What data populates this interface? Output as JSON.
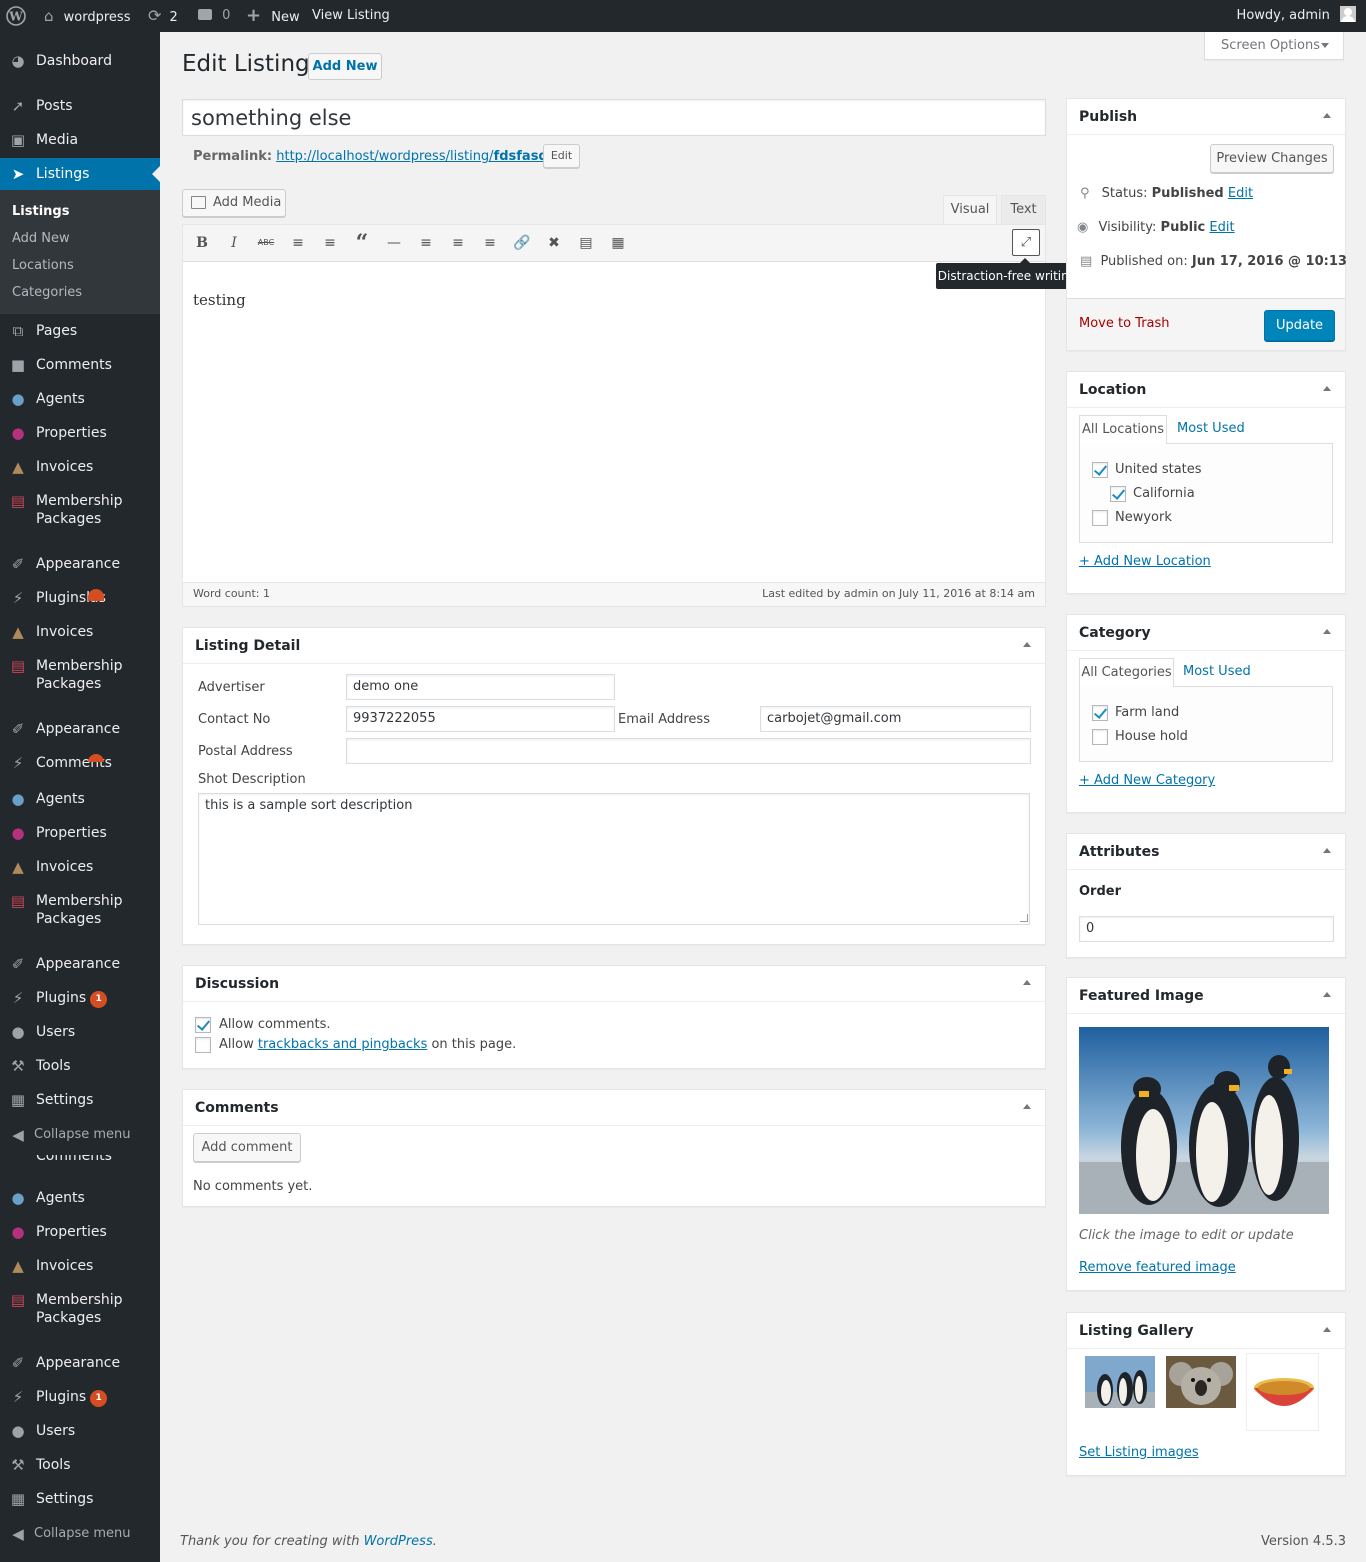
{
  "adminbar": {
    "site_name": "wordpress",
    "updates_count": "2",
    "comments_count": "0",
    "new_label": "New",
    "view_label": "View Listing",
    "greeting": "Howdy, admin"
  },
  "sidebar": {
    "dashboard": "Dashboard",
    "posts": "Posts",
    "media": "Media",
    "listings": "Listings",
    "submenu": [
      "Listings",
      "Add New",
      "Locations",
      "Categories"
    ],
    "pages": "Pages",
    "comments": "Comments",
    "agents": "Agents",
    "properties": "Properties",
    "invoices": "Invoices",
    "membership_1": "Membership",
    "membership_2": "Packages",
    "appearance": "Appearance",
    "plugins": "Plugins",
    "plugins_badge": "1",
    "users": "Users",
    "tools": "Tools",
    "settings": "Settings",
    "collapse": "Collapse menu",
    "overlap_text": "Pluginslas"
  },
  "header": {
    "title": "Edit Listing",
    "add_new": "Add New",
    "screen_options": "Screen Options"
  },
  "post": {
    "title_value": "something else",
    "permalink_label": "Permalink:",
    "permalink_base": "http://localhost/wordpress/listing/",
    "permalink_slug": "fdsfasdfsa",
    "permalink_slash": "/",
    "edit_button": "Edit",
    "content": "testing"
  },
  "editor": {
    "add_media": "Add Media",
    "tab_visual": "Visual",
    "tab_text": "Text",
    "tooltip": "Distraction-free writing mode",
    "word_count": "Word count: 1",
    "last_edited": "Last edited by admin on July 11, 2016 at 8:14 am"
  },
  "listing_detail": {
    "title": "Listing Detail",
    "advertiser_label": "Advertiser",
    "advertiser_value": "demo one",
    "contact_label": "Contact No",
    "contact_value": "9937222055",
    "email_label": "Email Address",
    "email_value": "carbojet@gmail.com",
    "postal_label": "Postal Address",
    "postal_value": "",
    "short_desc_label": "Shot Description",
    "short_desc_value": "this is a sample sort description"
  },
  "discussion": {
    "title": "Discussion",
    "allow_comments": "Allow comments.",
    "allow_prefix": "Allow ",
    "trackbacks_link": "trackbacks and pingbacks",
    "allow_suffix": " on this page."
  },
  "comments_box": {
    "title": "Comments",
    "add_comment": "Add comment",
    "none": "No comments yet."
  },
  "publish": {
    "title": "Publish",
    "preview": "Preview Changes",
    "status_label": "Status: ",
    "status_value": "Published",
    "visibility_label": "Visibility: ",
    "visibility_value": "Public",
    "edit_link": "Edit",
    "published_label": "Published on: ",
    "published_value": "Jun 17, 2016 @ 10:13",
    "trash": "Move to Trash",
    "update": "Update"
  },
  "location": {
    "title": "Location",
    "tab_all": "All Locations",
    "tab_most": "Most Used",
    "items": [
      "United states",
      "California",
      "Newyork"
    ],
    "add_new": "+ Add New Location"
  },
  "category": {
    "title": "Category",
    "tab_all": "All Categories",
    "tab_most": "Most Used",
    "items": [
      "Farm land",
      "House hold"
    ],
    "add_new": "+ Add New Category"
  },
  "attributes": {
    "title": "Attributes",
    "order_label": "Order",
    "order_value": "0"
  },
  "featured": {
    "title": "Featured Image",
    "hint": "Click the image to edit or update",
    "remove": "Remove featured image"
  },
  "gallery": {
    "title": "Listing Gallery",
    "set_images": "Set Listing images"
  },
  "footer": {
    "thanks_prefix": "Thank you for creating with ",
    "wp_link": "WordPress",
    "thanks_suffix": ".",
    "version": "Version 4.5.3"
  },
  "colors": {
    "admin_bar": "#23282d",
    "menu_current": "#0073aa",
    "primary_button": "#0085ba",
    "link": "#0073aa",
    "trash": "#a00",
    "badge": "#d54e21"
  }
}
